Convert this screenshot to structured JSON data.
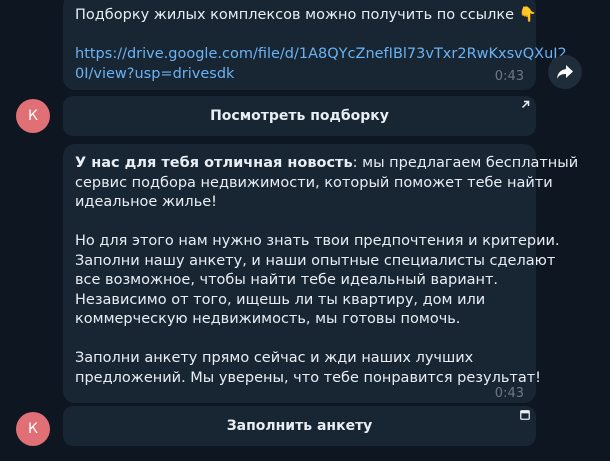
{
  "messages": [
    {
      "lines": [
        {
          "text": "Подборку жилых комплексов можно получить по ссылке 👇"
        },
        {
          "text": ""
        },
        {
          "text": "https://drive.google.com/file/d/1A8QYcZnefIBl73vTxr2RwKxsvQXuJ2",
          "link": true
        },
        {
          "text": "0I/view?usp=drivesdk",
          "link": true
        }
      ],
      "time": "0:43",
      "button": {
        "label": "Посмотреть подборку",
        "icon": "external-link-arrow-icon"
      }
    },
    {
      "bold_intro": "У нас для тебя отличная новость",
      "intro_rest": ": мы предлагаем бесплатный",
      "lines": [
        "сервис подбора недвижимости, который поможет тебе найти",
        "идеальное жилье!",
        "",
        "Но для этого нам нужно знать твои предпочтения и критерии.",
        "Заполни нашу анкету, и наши опытные специалисты сделают",
        "все возможное, чтобы найти тебе идеальный вариант.",
        "Независимо от того, ищешь ли ты квартиру, дом или",
        "коммерческую недвижимость, мы готовы помочь.",
        "",
        "Заполни анкету прямо сейчас и жди наших лучших",
        "предложений. Мы уверены, что тебе понравится результат!"
      ],
      "time": "0:43",
      "button": {
        "label": "Заполнить анкету",
        "icon": "web-app-window-icon"
      }
    }
  ],
  "avatar": {
    "letter": "К",
    "color": "#e17076"
  },
  "share": {
    "icon": "share-forward-icon"
  }
}
